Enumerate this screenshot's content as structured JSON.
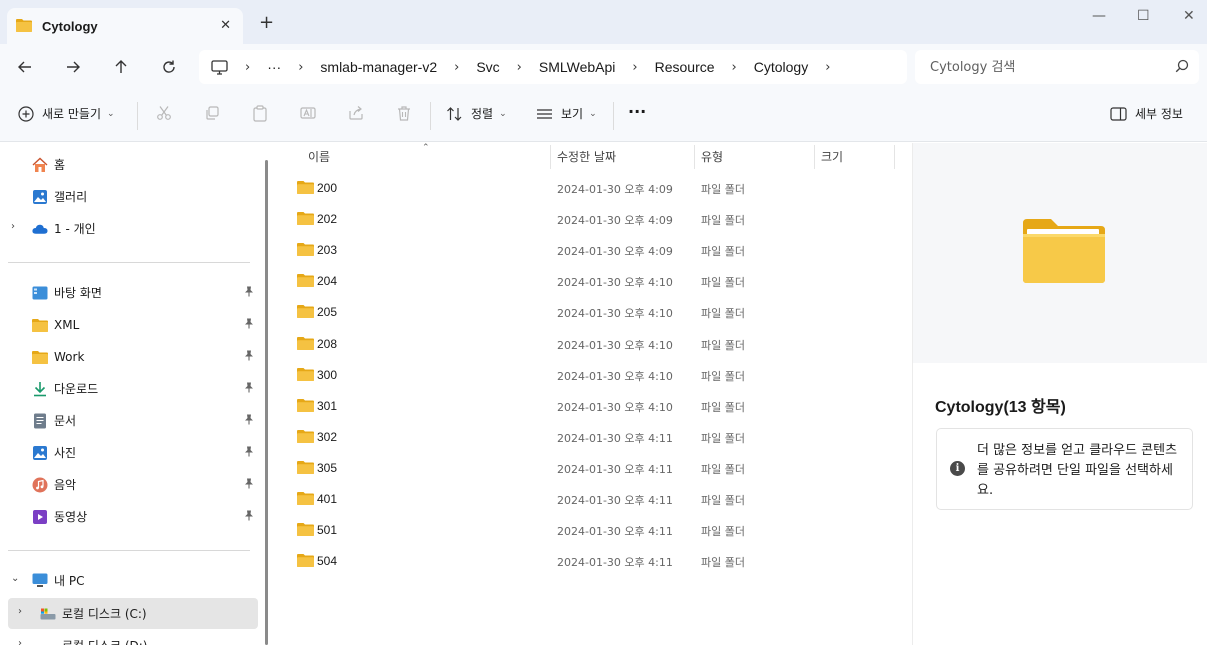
{
  "tab": {
    "title": "Cytology",
    "close": "✕",
    "new_tab": "+"
  },
  "window": {
    "minimize": "—",
    "maximize": "☐",
    "close": "✕"
  },
  "breadcrumb": [
    "···",
    "smlab-manager-v2",
    "Svc",
    "SMLWebApi",
    "Resource",
    "Cytology"
  ],
  "search": {
    "placeholder": "Cytology 검색"
  },
  "toolbar": {
    "new_label": "새로 만들기",
    "sort_label": "정렬",
    "view_label": "보기",
    "more_label": "···",
    "details_label": "세부 정보"
  },
  "sidebar": {
    "top": [
      {
        "label": "홈",
        "icon": "home-icon"
      },
      {
        "label": "갤러리",
        "icon": "gallery-icon"
      },
      {
        "label": "1 - 개인",
        "icon": "onedrive-icon"
      }
    ],
    "pinned": [
      {
        "label": "바탕 화면",
        "icon": "desktop-icon"
      },
      {
        "label": "XML",
        "icon": "folder-icon"
      },
      {
        "label": "Work",
        "icon": "folder-icon"
      },
      {
        "label": "다운로드",
        "icon": "download-icon"
      },
      {
        "label": "문서",
        "icon": "document-icon"
      },
      {
        "label": "사진",
        "icon": "pictures-icon"
      },
      {
        "label": "음악",
        "icon": "music-icon"
      },
      {
        "label": "동영상",
        "icon": "video-icon"
      }
    ],
    "pc": [
      {
        "label": "내 PC",
        "icon": "pc-icon"
      },
      {
        "label": "로컬 디스크 (C:)",
        "icon": "drive-icon"
      },
      {
        "label": "로컬 디스크 (D:)",
        "icon": "drive-icon"
      }
    ]
  },
  "columns": {
    "name": "이름",
    "date": "수정한 날짜",
    "type": "유형",
    "size": "크기"
  },
  "files": [
    {
      "name": "200",
      "date": "2024-01-30 오후 4:09",
      "type": "파일 폴더"
    },
    {
      "name": "202",
      "date": "2024-01-30 오후 4:09",
      "type": "파일 폴더"
    },
    {
      "name": "203",
      "date": "2024-01-30 오후 4:09",
      "type": "파일 폴더"
    },
    {
      "name": "204",
      "date": "2024-01-30 오후 4:10",
      "type": "파일 폴더"
    },
    {
      "name": "205",
      "date": "2024-01-30 오후 4:10",
      "type": "파일 폴더"
    },
    {
      "name": "208",
      "date": "2024-01-30 오후 4:10",
      "type": "파일 폴더"
    },
    {
      "name": "300",
      "date": "2024-01-30 오후 4:10",
      "type": "파일 폴더"
    },
    {
      "name": "301",
      "date": "2024-01-30 오후 4:10",
      "type": "파일 폴더"
    },
    {
      "name": "302",
      "date": "2024-01-30 오후 4:11",
      "type": "파일 폴더"
    },
    {
      "name": "305",
      "date": "2024-01-30 오후 4:11",
      "type": "파일 폴더"
    },
    {
      "name": "401",
      "date": "2024-01-30 오후 4:11",
      "type": "파일 폴더"
    },
    {
      "name": "501",
      "date": "2024-01-30 오후 4:11",
      "type": "파일 폴더"
    },
    {
      "name": "504",
      "date": "2024-01-30 오후 4:11",
      "type": "파일 폴더"
    }
  ],
  "details": {
    "title": "Cytology(13 항목)",
    "info": "더 많은 정보를 얻고 클라우드 콘텐츠를 공유하려면 단일 파일을 선택하세요."
  },
  "colors": {
    "folder": "#f5c242",
    "folder_dark": "#e6a817",
    "accent": "#0067c0",
    "selected": "#e5e5e5"
  }
}
